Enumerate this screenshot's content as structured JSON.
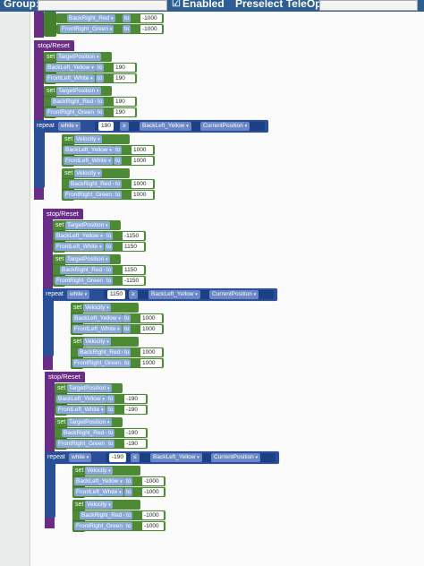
{
  "topbar": {
    "group_label": "Group:",
    "enabled_label": "Enabled",
    "preselect_label": "Preselect TeleOp:"
  },
  "common": {
    "set": "set",
    "to": "to",
    "repeat": "repeat",
    "do": "do",
    "while": "while",
    "dd": "▾"
  },
  "partial": {
    "lines": [
      {
        "var": "BackRight_Red",
        "value": "-1000"
      },
      {
        "var": "FrontRight_Green",
        "value": "-1000"
      }
    ]
  },
  "groups": [
    {
      "title": "stop/Reset",
      "set_target": "TargetPosition",
      "target_lines": [
        {
          "var": "BackLeft_Yellow",
          "value": "190"
        },
        {
          "var": "FrontLeft_White",
          "value": "190"
        }
      ],
      "set_target2": "TargetPosition",
      "target_lines2": [
        {
          "var": "BackRight_Red",
          "value": "190"
        },
        {
          "var": "FrontRight_Green",
          "value": "190"
        }
      ],
      "repeat_mode": "while",
      "cond_value": "190",
      "cond_op": "≥",
      "cond_var": "BackLeft_Yellow",
      "cond_prop": "CurrentPosition",
      "set_velocity": "Velocity",
      "velocity_lines": [
        {
          "var": "BackLeft_Yellow",
          "value": "1000"
        },
        {
          "var": "FrontLeft_White",
          "value": "1000"
        }
      ],
      "set_velocity2": "Velocity",
      "velocity_lines2": [
        {
          "var": "BackRight_Red",
          "value": "1000"
        },
        {
          "var": "FrontRight_Green",
          "value": "1000"
        }
      ]
    },
    {
      "title": "stop/Reset",
      "set_target": "TargetPosition",
      "target_lines": [
        {
          "var": "BackLeft_Yellow",
          "value": "-1150"
        },
        {
          "var": "FrontLeft_White",
          "value": "1150"
        }
      ],
      "set_target2": "TargetPosition",
      "target_lines2": [
        {
          "var": "BackRight_Red",
          "value": "1150"
        },
        {
          "var": "FrontRight_Green",
          "value": "-1150"
        }
      ],
      "repeat_mode": "while",
      "cond_value": "1150",
      "cond_op": "≥",
      "cond_var": "BackLeft_Yellow",
      "cond_prop": "CurrentPosition",
      "set_velocity": "Velocity",
      "velocity_lines": [
        {
          "var": "BackLeft_Yellow",
          "value": "1000"
        },
        {
          "var": "FrontLeft_White",
          "value": "1000"
        }
      ],
      "set_velocity2": "Velocity",
      "velocity_lines2": [
        {
          "var": "BackRight_Red",
          "value": "1000"
        },
        {
          "var": "FrontRight_Green",
          "value": "1000"
        }
      ]
    },
    {
      "title": "stop/Reset",
      "set_target": "TargetPosition",
      "target_lines": [
        {
          "var": "BackLeft_Yellow",
          "value": "-190"
        },
        {
          "var": "FrontLeft_White",
          "value": "-190"
        }
      ],
      "set_target2": "TargetPosition",
      "target_lines2": [
        {
          "var": "BackRight_Red",
          "value": "-190"
        },
        {
          "var": "FrontRight_Green",
          "value": "-190"
        }
      ],
      "repeat_mode": "while",
      "cond_value": "-190",
      "cond_op": "≤",
      "cond_var": "BackLeft_Yellow",
      "cond_prop": "CurrentPosition",
      "set_velocity": "Velocity",
      "velocity_lines": [
        {
          "var": "BackLeft_Yellow",
          "value": "-1000"
        },
        {
          "var": "FrontLeft_White",
          "value": "-1000"
        }
      ],
      "set_velocity2": "Velocity",
      "velocity_lines2": [
        {
          "var": "BackRight_Red",
          "value": "-1000"
        },
        {
          "var": "FrontRight_Green",
          "value": "-1000"
        }
      ]
    }
  ]
}
